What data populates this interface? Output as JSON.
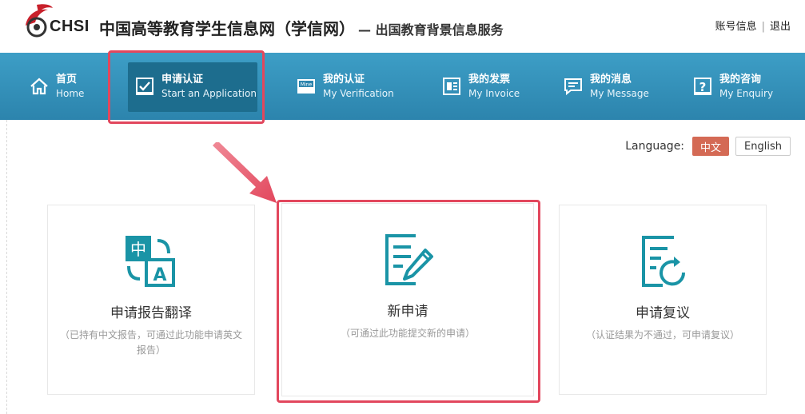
{
  "header": {
    "logo_text": "CHSI",
    "title": "中国高等教育学生信息网（学信网）",
    "subtitle": "— 出国教育背景信息服务",
    "links": {
      "account": "账号信息",
      "logout": "退出"
    }
  },
  "nav": {
    "items": [
      {
        "zh": "首页",
        "en": "Home",
        "icon": "home-icon"
      },
      {
        "zh": "申请认证",
        "en": "Start an Application",
        "icon": "checkbox-icon",
        "active": true
      },
      {
        "zh": "我的认证",
        "en": "My Verification",
        "icon": "certificate-icon"
      },
      {
        "zh": "我的发票",
        "en": "My Invoice",
        "icon": "invoice-icon"
      },
      {
        "zh": "我的消息",
        "en": "My Message",
        "icon": "message-icon"
      },
      {
        "zh": "我的咨询",
        "en": "My Enquiry",
        "icon": "question-icon"
      }
    ]
  },
  "language": {
    "label": "Language:",
    "zh": "中文",
    "en": "English",
    "selected": "中文"
  },
  "cards": [
    {
      "title": "申请报告翻译",
      "desc": "（已持有中文报告，可通过此功能申请英文报告）",
      "icon": "translate-icon"
    },
    {
      "title": "新申请",
      "desc": "（可通过此功能提交新的申请）",
      "icon": "edit-document-icon"
    },
    {
      "title": "申请复议",
      "desc": "（认证结果为不通过，可申请复议）",
      "icon": "refresh-document-icon"
    }
  ],
  "colors": {
    "nav_bg": "#3393bb",
    "nav_active": "#1d6d8e",
    "accent_teal": "#1a94a6",
    "highlight": "#e2475d",
    "lang_active": "#d46a55"
  }
}
